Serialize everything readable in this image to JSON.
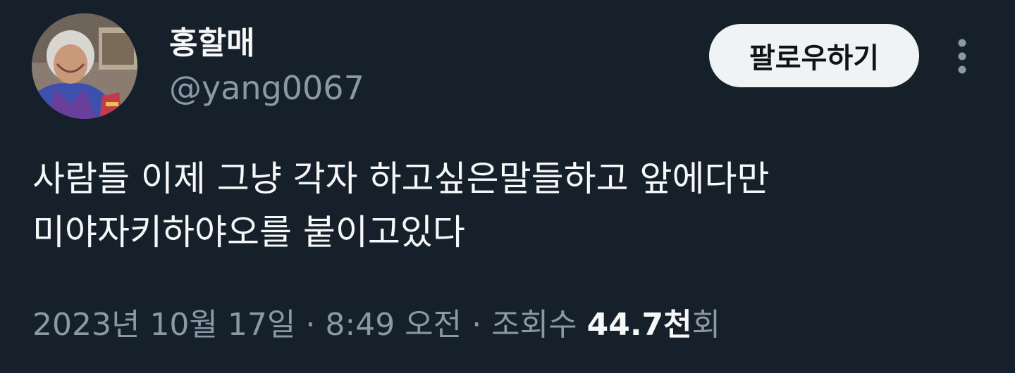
{
  "author": {
    "display_name": "홍할매",
    "handle": "@yang0067",
    "avatar_icon": "profile-photo-elderly-woman-hanbok"
  },
  "actions": {
    "follow_label": "팔로우하기",
    "more_icon": "vertical-ellipsis-icon"
  },
  "tweet": {
    "lines": [
      "사람들 이제 그냥 각자 하고싶은말들하고 앞에다만",
      "미야자키하야오를 붙이고있다"
    ]
  },
  "meta": {
    "date": "2023년 10월 17일",
    "separator": "·",
    "time": "8:49 오전",
    "views_label": "조회수",
    "views_value": "44.7천",
    "views_suffix": "회"
  },
  "colors": {
    "background": "#15202b",
    "text_primary": "#f7f9f9",
    "text_secondary": "#8b98a5",
    "button_bg": "#eff3f4",
    "button_text": "#0f1419"
  }
}
